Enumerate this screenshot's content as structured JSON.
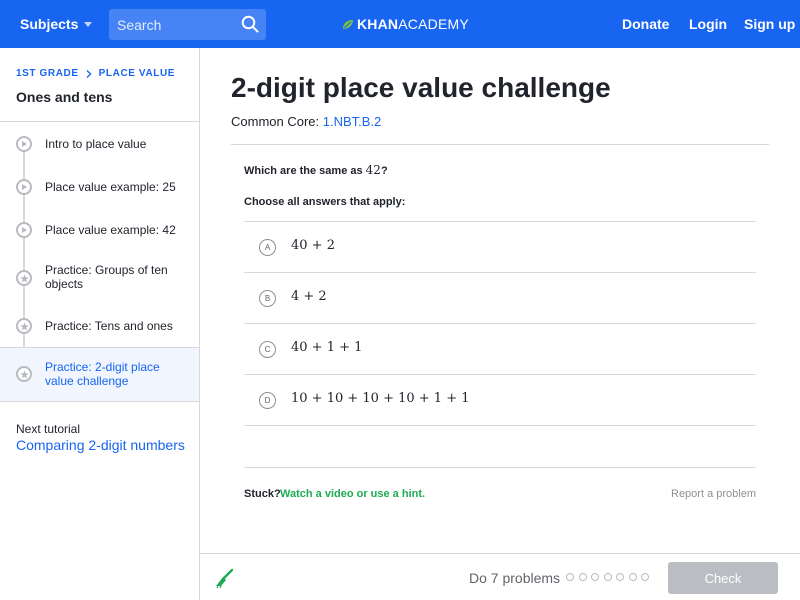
{
  "header": {
    "subjects_label": "Subjects",
    "search_placeholder": "Search",
    "logo_part1": "KHAN",
    "logo_part2": "ACADEMY",
    "donate_label": "Donate",
    "login_label": "Login",
    "signup_label": "Sign up",
    "brand_color": "#1865f2"
  },
  "sidebar": {
    "breadcrumb_grade": "1ST GRADE",
    "breadcrumb_topic": "PLACE VALUE",
    "unit_title": "Ones and tens",
    "items": [
      {
        "label": "Intro to place value",
        "type": "video"
      },
      {
        "label": "Place value example: 25",
        "type": "video"
      },
      {
        "label": "Place value example: 42",
        "type": "video"
      },
      {
        "label": "Practice: Groups of ten objects",
        "type": "exercise"
      },
      {
        "label": "Practice: Tens and ones",
        "type": "exercise"
      },
      {
        "label": "Practice: 2-digit place value challenge",
        "type": "exercise",
        "active": true
      }
    ],
    "next_label": "Next tutorial",
    "next_link": "Comparing 2-digit numbers"
  },
  "main": {
    "title": "2-digit place value challenge",
    "common_core_label": "Common Core:",
    "common_core_code": "1.NBT.B.2",
    "question_text": "Which are the same as",
    "question_number": "42",
    "question_mark": "?",
    "instruction": "Choose all answers that apply:",
    "choices": [
      {
        "letter": "A",
        "expr": "40 + 2"
      },
      {
        "letter": "B",
        "expr": "4 + 2"
      },
      {
        "letter": "C",
        "expr": "40 + 1 + 1"
      },
      {
        "letter": "D",
        "expr": "10 + 10 + 10 + 10 + 1 + 1"
      }
    ],
    "stuck_label": "Stuck?",
    "hint_label": "Watch a video or use a hint.",
    "report_label": "Report a problem"
  },
  "footer": {
    "do_problems": "Do 7 problems",
    "progress_count": 7,
    "progress_completed": 0,
    "check_label": "Check"
  }
}
